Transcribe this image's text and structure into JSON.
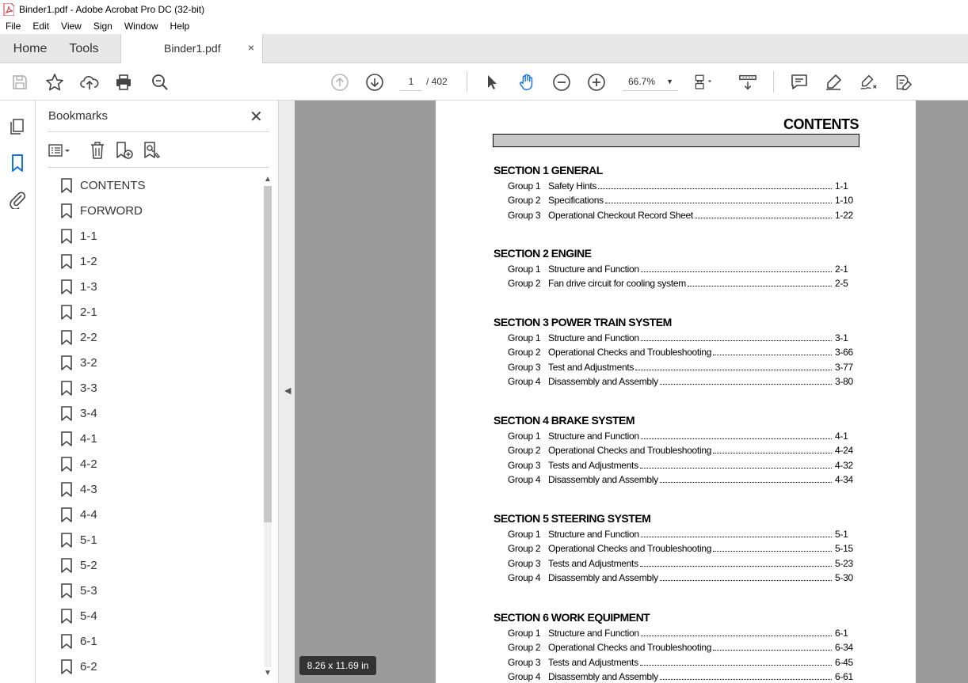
{
  "window": {
    "title": "Binder1.pdf - Adobe Acrobat Pro DC (32-bit)"
  },
  "menu": [
    "File",
    "Edit",
    "View",
    "Sign",
    "Window",
    "Help"
  ],
  "tabs": {
    "home": "Home",
    "tools": "Tools",
    "document": "Binder1.pdf",
    "close_glyph": "×"
  },
  "toolbar": {
    "icons": [
      "save-icon",
      "star-icon",
      "upload-icon",
      "print-icon",
      "search-zoom-icon",
      "prev-page-icon",
      "next-page-icon",
      "select-cursor-icon",
      "hand-icon",
      "zoom-out-icon",
      "zoom-in-icon",
      "page-fit-icon",
      "scroll-mode-icon",
      "comment-icon",
      "highlight-icon",
      "sign-icon",
      "edit-pdf-icon"
    ],
    "current_page": "1",
    "page_total": "/  402",
    "zoom": "66.7%"
  },
  "bookmarks": {
    "title": "Bookmarks",
    "close_glyph": "✕",
    "items": [
      "CONTENTS",
      "FORWORD",
      "1-1",
      "1-2",
      "1-3",
      "2-1",
      "2-2",
      "3-2",
      "3-3",
      "3-4",
      "4-1",
      "4-2",
      "4-3",
      "4-4",
      "5-1",
      "5-2",
      "5-3",
      "5-4",
      "6-1",
      "6-2"
    ]
  },
  "page_size": "8.26 x 11.69 in",
  "document": {
    "title": "CONTENTS",
    "sections": [
      {
        "heading": "SECTION 1  GENERAL",
        "groups": [
          {
            "group": "Group   1",
            "title": "Safety Hints",
            "page": "1-1"
          },
          {
            "group": "Group   2",
            "title": "Specifications",
            "page": "1-10"
          },
          {
            "group": "Group   3",
            "title": "Operational Checkout Record Sheet",
            "page": "1-22"
          }
        ]
      },
      {
        "heading": "SECTION 2  ENGINE",
        "groups": [
          {
            "group": "Group   1",
            "title": "Structure and Function",
            "page": "2-1"
          },
          {
            "group": "Group   2",
            "title": "Fan drive circuit for cooling system",
            "page": "2-5"
          }
        ]
      },
      {
        "heading": "SECTION 3  POWER TRAIN SYSTEM",
        "groups": [
          {
            "group": "Group   1",
            "title": "Structure and Function",
            "page": "3-1"
          },
          {
            "group": "Group   2",
            "title": "Operational Checks and Troubleshooting",
            "page": "3-66"
          },
          {
            "group": "Group   3",
            "title": "Test and Adjustments",
            "page": "3-77"
          },
          {
            "group": "Group   4",
            "title": "Disassembly and Assembly",
            "page": "3-80"
          }
        ]
      },
      {
        "heading": "SECTION 4  BRAKE SYSTEM",
        "groups": [
          {
            "group": "Group   1",
            "title": "Structure and Function",
            "page": "4-1"
          },
          {
            "group": "Group   2",
            "title": "Operational Checks and Troubleshooting",
            "page": "4-24"
          },
          {
            "group": "Group   3",
            "title": "Tests and Adjustments",
            "page": "4-32"
          },
          {
            "group": "Group   4",
            "title": "Disassembly and Assembly",
            "page": "4-34"
          }
        ]
      },
      {
        "heading": "SECTION 5  STEERING SYSTEM",
        "groups": [
          {
            "group": "Group   1",
            "title": "Structure and Function",
            "page": "5-1"
          },
          {
            "group": "Group   2",
            "title": "Operational Checks and Troubleshooting",
            "page": "5-15"
          },
          {
            "group": "Group   3",
            "title": "Tests and Adjustments",
            "page": "5-23"
          },
          {
            "group": "Group   4",
            "title": "Disassembly and Assembly",
            "page": "5-30"
          }
        ]
      },
      {
        "heading": "SECTION 6  WORK EQUIPMENT",
        "groups": [
          {
            "group": "Group   1",
            "title": "Structure and Function",
            "page": "6-1"
          },
          {
            "group": "Group   2",
            "title": "Operational Checks and Troubleshooting",
            "page": "6-34"
          },
          {
            "group": "Group   3",
            "title": "Tests and Adjustments",
            "page": "6-45"
          },
          {
            "group": "Group   4",
            "title": "Disassembly and Assembly",
            "page": "6-61"
          }
        ]
      }
    ]
  }
}
